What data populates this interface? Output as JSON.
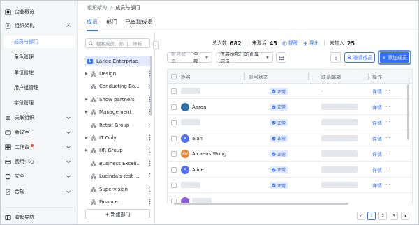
{
  "sidebar": {
    "items": [
      {
        "label": "企业概览",
        "icon": "overview-icon"
      },
      {
        "label": "组织架构",
        "icon": "org-icon",
        "expanded": true
      },
      {
        "label": "关联组织",
        "icon": "link-org-icon"
      },
      {
        "label": "会议室",
        "icon": "meeting-room-icon"
      },
      {
        "label": "工作台",
        "icon": "workplace-icon",
        "badge": true
      },
      {
        "label": "费用中心",
        "icon": "billing-icon"
      },
      {
        "label": "安全",
        "icon": "shield-icon"
      },
      {
        "label": "合规",
        "icon": "compliance-icon"
      }
    ],
    "sub_items": [
      "成员与部门",
      "角色管理",
      "单位管理",
      "用户组管理",
      "字段管理"
    ],
    "active_sub": "成员与部门",
    "collapse_label": "收起导航"
  },
  "breadcrumb": {
    "parent": "组织架构",
    "separator": "/",
    "current": "成员与部门"
  },
  "tabs": [
    {
      "label": "成员",
      "active": true
    },
    {
      "label": "部门",
      "active": false
    },
    {
      "label": "已离职成员",
      "active": false
    }
  ],
  "dept_panel": {
    "search_placeholder": "搜索成员、部门、邮箱...",
    "root": {
      "logo": "L",
      "name": "Larkie Enterprise"
    },
    "departments": [
      {
        "name": "Design",
        "expandable": true
      },
      {
        "name": "Conducting Bo...",
        "expandable": false
      },
      {
        "name": "Show partners",
        "expandable": true
      },
      {
        "name": "Management",
        "expandable": true
      },
      {
        "name": "Retail Group",
        "expandable": false
      },
      {
        "name": "IT Only",
        "expandable": true
      },
      {
        "name": "HR Group",
        "expandable": true
      },
      {
        "name": "Business Excell...",
        "expandable": false
      },
      {
        "name": "Lucinda's test ...",
        "expandable": false
      },
      {
        "name": "Supervision",
        "expandable": false
      },
      {
        "name": "Finance",
        "expandable": false
      }
    ],
    "new_dept_label": "+ 新建部门"
  },
  "stats": {
    "total_label": "总人数",
    "total": "682",
    "inactive_label": "未激活",
    "inactive": "45",
    "remind_label": "提醒",
    "export_label": "导出",
    "not_joined_label": "未加入",
    "not_joined": "25"
  },
  "filters": {
    "status_label": "账号状态:",
    "status_value": "全部",
    "scope_value": "仅展示部门的直属成员"
  },
  "actions": {
    "invite": "邀请成员",
    "add": "+ 添加成员"
  },
  "table": {
    "headers": [
      "姓名",
      "账号状态",
      "联系邮箱",
      "操作"
    ],
    "rows": [
      {
        "name": "",
        "avatar_text": "",
        "avatar_color": "",
        "status": "正常",
        "email": "-",
        "op": "详情"
      },
      {
        "name": "Aaron",
        "avatar_text": "",
        "avatar_color": "#2f6fa8",
        "status": "正常",
        "email": "",
        "op": "详情"
      },
      {
        "name": "",
        "avatar_text": "",
        "avatar_color": "",
        "status": "正常",
        "email": "",
        "op": "详情"
      },
      {
        "name": "alan",
        "avatar_text": "A",
        "avatar_color": "#4e6ef2",
        "status": "正常",
        "email": "",
        "op": "详情"
      },
      {
        "name": "Alcaeus Wong",
        "avatar_text": "AW",
        "avatar_color": "#e8833a",
        "status": "正常",
        "email": "",
        "op": "详情"
      },
      {
        "name": "Alice",
        "avatar_text": "A",
        "avatar_color": "#4e6ef2",
        "status": "正常",
        "email": "",
        "op": "详情"
      },
      {
        "name": "",
        "avatar_text": "",
        "avatar_color": "",
        "status": "正常",
        "email": "",
        "op": "详情"
      },
      {
        "name": "",
        "avatar_text": "",
        "avatar_color": "#8d59e3",
        "status": "",
        "email": "",
        "op": ""
      }
    ],
    "more_label": "···"
  },
  "pagination": {
    "pages": [
      "1",
      "2",
      "3"
    ],
    "current": "1"
  },
  "colors": {
    "accent": "#3370ff",
    "status_bg": "#e1eaff",
    "sidebar_bg": "#f5f6f7"
  }
}
